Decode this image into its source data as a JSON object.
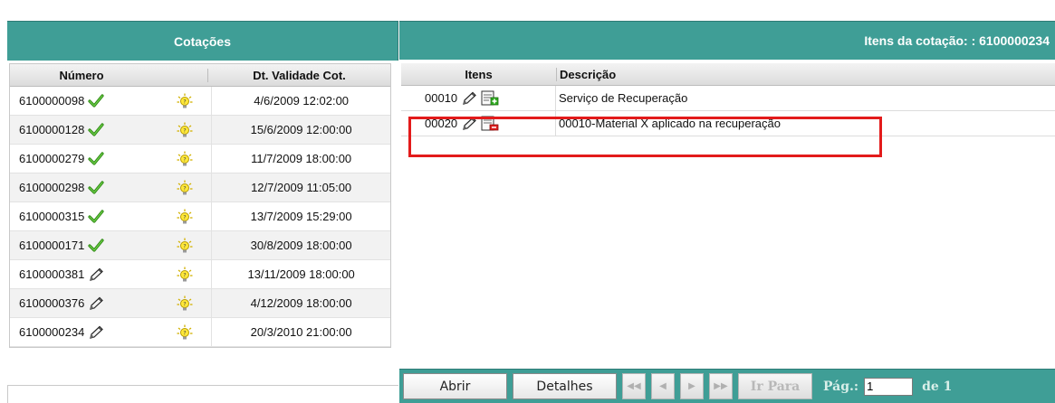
{
  "left_panel": {
    "title": "Cotações",
    "headers": {
      "numero": "Número",
      "validade": "Dt. Validade Cot."
    },
    "rows": [
      {
        "numero": "6100000098",
        "status": "check",
        "date": "4/6/2009 12:02:00"
      },
      {
        "numero": "6100000128",
        "status": "check",
        "date": "15/6/2009 12:00:00"
      },
      {
        "numero": "6100000279",
        "status": "check",
        "date": "11/7/2009 18:00:00"
      },
      {
        "numero": "6100000298",
        "status": "check",
        "date": "12/7/2009 11:05:00"
      },
      {
        "numero": "6100000315",
        "status": "check",
        "date": "13/7/2009 15:29:00"
      },
      {
        "numero": "6100000171",
        "status": "check",
        "date": "30/8/2009 18:00:00"
      },
      {
        "numero": "6100000381",
        "status": "pencil",
        "date": "13/11/2009 18:00:00"
      },
      {
        "numero": "6100000376",
        "status": "pencil",
        "date": "4/12/2009 18:00:00"
      },
      {
        "numero": "6100000234",
        "status": "pencil",
        "date": "20/3/2010 21:00:00"
      }
    ]
  },
  "right_panel": {
    "title": "Itens da cotação: : 6100000234",
    "headers": {
      "itens": "Itens",
      "descricao": "Descrição"
    },
    "rows": [
      {
        "item": "00010",
        "descricao": "Serviço de Recuperação",
        "action_icon": "add-icon"
      },
      {
        "item": "00020",
        "descricao": "00010-Material X aplicado na recuperação",
        "action_icon": "remove-icon"
      }
    ]
  },
  "toolbar": {
    "abrir": "Abrir",
    "detalhes": "Detalhes",
    "ir_para": "Ir Para",
    "pag_label": "Pág.:",
    "pag_value": "1",
    "de_label": "de 1"
  },
  "colors": {
    "header_teal": "#3f9e96",
    "highlight_red": "#e31b1b",
    "check_green": "#3a9a1a"
  }
}
